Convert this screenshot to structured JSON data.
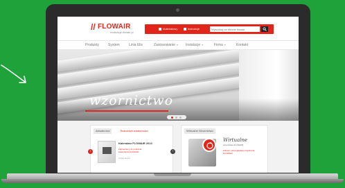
{
  "header": {
    "logo_mark": "//",
    "logo_text": "FLOWAIR",
    "logo_tagline": "realizacje.flowair.pl",
    "top_buttons": [
      "Materiałowy",
      "Instrukcje"
    ],
    "search_placeholder": "Wyszukaj na stronie flowair"
  },
  "nav": {
    "items": [
      "Produkty",
      "System",
      "Linia Elis",
      "Zastosowanie",
      "Instalacje",
      "Firma",
      "Kontakt"
    ]
  },
  "hero": {
    "title": "wzornictwo"
  },
  "panel_left": {
    "tabs": [
      "Aktualności",
      "Branżowe wiadomości"
    ],
    "title": "Kalendarz FLOWAIR 2013",
    "description": "Zapraszamy do pobrania kalendarza FLOWAIR",
    "more": "czytaj więcej"
  },
  "panel_right": {
    "tab": "Wirtualne Wzornictwo",
    "title": "Wirtualne",
    "subtitle": "wzornictwo FLOWAIR",
    "description": "Zobacz, jak wyglądają urządzenia FLOWAIR"
  },
  "colors": {
    "brand_red": "#e1251b",
    "background_green": "#1fa23a"
  }
}
